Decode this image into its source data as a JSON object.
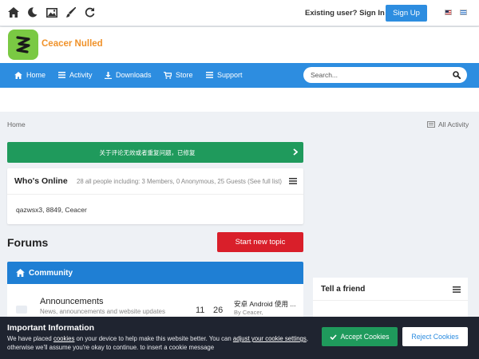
{
  "topbar": {
    "icons": [
      "home-icon",
      "moon-icon",
      "image-icon",
      "brush-icon",
      "refresh-icon"
    ],
    "signin_label": "Existing user? Sign In",
    "signup_label": "Sign Up"
  },
  "brand": {
    "name": "Ceacer Nulled",
    "logo_color": "#7ac943",
    "name_color": "#f0922a"
  },
  "nav": {
    "items": [
      {
        "label": "Home",
        "icon": "home-icon"
      },
      {
        "label": "Activity",
        "icon": "list-icon"
      },
      {
        "label": "Downloads",
        "icon": "download-icon"
      },
      {
        "label": "Store",
        "icon": "cart-icon"
      },
      {
        "label": "Support",
        "icon": "list-icon"
      }
    ],
    "search_placeholder": "Search...",
    "color": "#2d8de0"
  },
  "breadcrumb": {
    "home": "Home",
    "all_activity": "All Activity"
  },
  "announcement": {
    "text": "关于评论无效或者重复问题，已修复",
    "color": "#1f9a5c"
  },
  "whos_online": {
    "title": "Who's Online",
    "count_text": "28 all people including: 3 Members, 0 Anonymous, 25 Guests (See full list)",
    "users": "qazwsx3, 8849, Ceacer"
  },
  "forums": {
    "title": "Forums",
    "new_topic_label": "Start new topic",
    "category": "Community",
    "rows": [
      {
        "title": "Announcements",
        "description": "News, announcements and website updates",
        "topics": "11",
        "posts": "26",
        "last_post": "安卓 Android 使用 ...",
        "last_by": "By Ceacer,"
      }
    ]
  },
  "sidebar": {
    "widget_title": "Tell a friend"
  },
  "cookie": {
    "title": "Important Information",
    "text_before": "We have placed ",
    "link1": "cookies",
    "text_mid": " on your device to help make this website better. You can ",
    "link2": "adjust your cookie settings",
    "text_after": ", otherwise we'll assume you're okay to continue. to insert a cookie message",
    "accept_label": "Accept Cookies",
    "reject_label": "Reject Cookies"
  }
}
